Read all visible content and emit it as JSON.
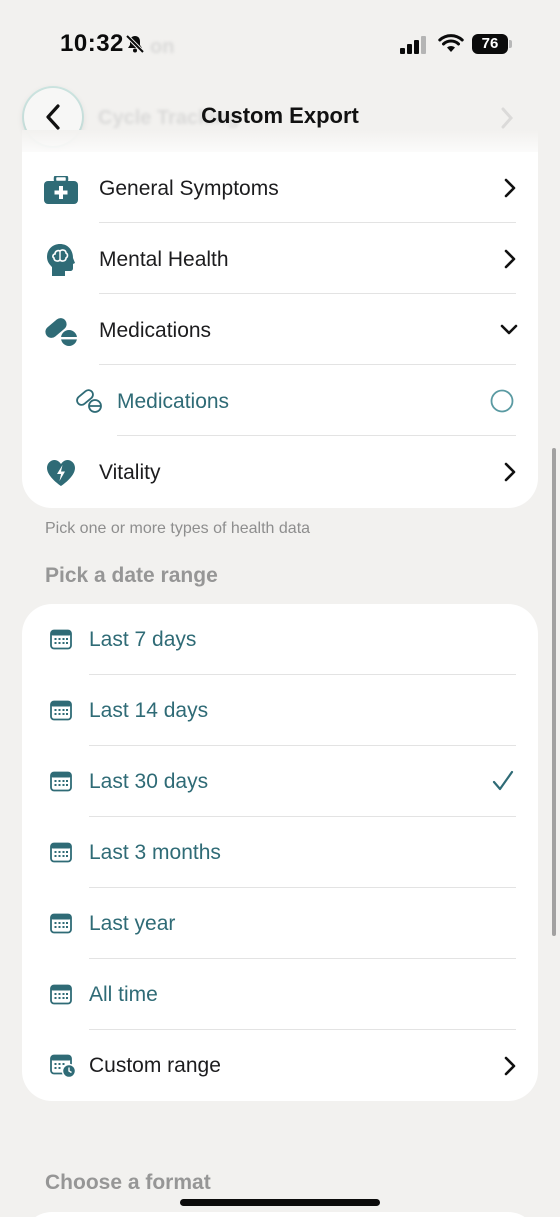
{
  "status_bar": {
    "time": "10:32",
    "battery": "76"
  },
  "ghost": {
    "behind_status": "on",
    "behind_nav": "Cycle Tracking"
  },
  "nav": {
    "title": "Custom Export"
  },
  "health_types": [
    {
      "label": "General Symptoms",
      "icon": "first-aid-kit-icon",
      "accessory": "chevron-right"
    },
    {
      "label": "Mental Health",
      "icon": "brain-head-icon",
      "accessory": "chevron-right"
    },
    {
      "label": "Medications",
      "icon": "pills-icon",
      "accessory": "chevron-down"
    },
    {
      "label": "Medications",
      "icon": "pill-outline-icon",
      "accessory": "radio-unselected",
      "sub": true
    },
    {
      "label": "Vitality",
      "icon": "heart-bolt-icon",
      "accessory": "chevron-right"
    }
  ],
  "hint": "Pick one or more types of health data",
  "date_range": {
    "header": "Pick a date range",
    "options": [
      {
        "label": "Last 7 days"
      },
      {
        "label": "Last 14 days"
      },
      {
        "label": "Last 30 days",
        "selected": true
      },
      {
        "label": "Last 3 months"
      },
      {
        "label": "Last year"
      },
      {
        "label": "All time"
      },
      {
        "label": "Custom range"
      }
    ]
  },
  "format": {
    "header": "Choose a format"
  },
  "colors": {
    "accent": "#2f6b76",
    "background": "#f2f1ef",
    "card": "#ffffff"
  }
}
